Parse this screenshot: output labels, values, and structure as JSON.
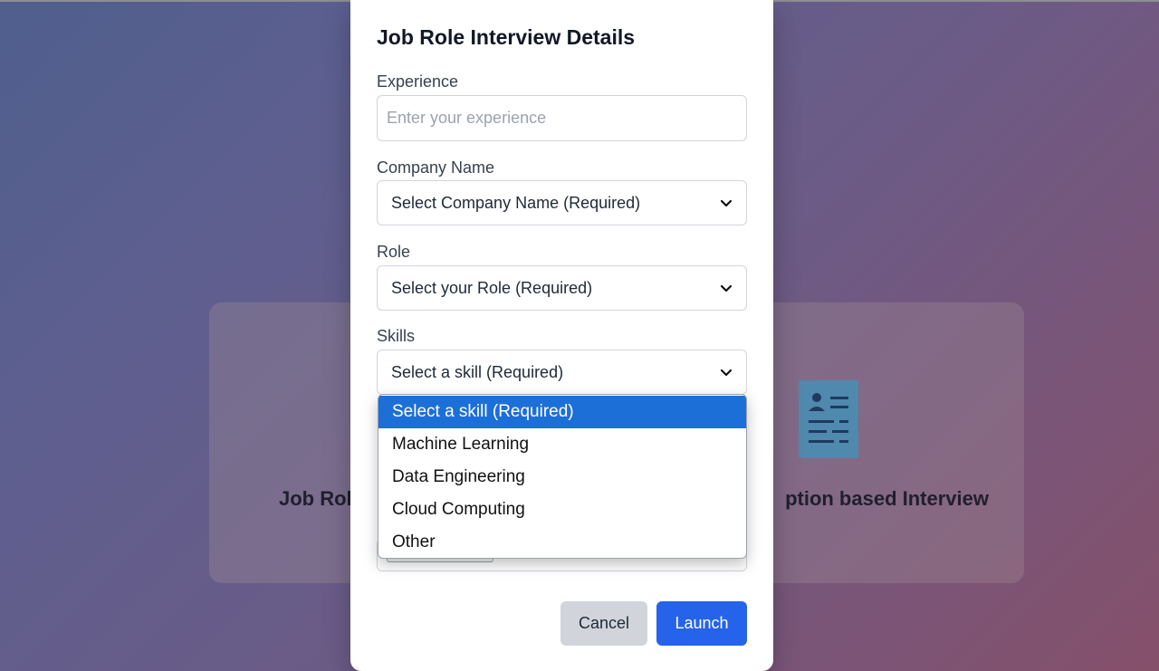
{
  "background": {
    "card_left_title": "Job Rol",
    "card_right_title": "ption based Interview",
    "card_right_icon": "document-profile-icon"
  },
  "modal": {
    "title": "Job Role Interview Details",
    "experience": {
      "label": "Experience",
      "placeholder": "Enter your experience",
      "value": ""
    },
    "company": {
      "label": "Company Name",
      "selected": "Select Company Name (Required)"
    },
    "role": {
      "label": "Role",
      "selected": "Select your Role (Required)"
    },
    "skills": {
      "label": "Skills",
      "selected": "Select a skill (Required)",
      "options": [
        "Select a skill (Required)",
        "Machine Learning",
        "Data Engineering",
        "Cloud Computing",
        "Other"
      ],
      "highlighted_index": 0
    },
    "buttons": {
      "cancel": "Cancel",
      "launch": "Launch"
    }
  },
  "colors": {
    "primary": "#2563eb",
    "highlight": "#1d6fd8",
    "cancel_bg": "#d1d5db"
  }
}
